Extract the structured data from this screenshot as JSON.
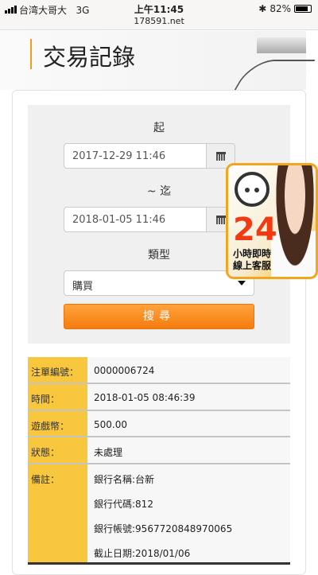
{
  "status": {
    "carrier": "台湾大哥大",
    "network": "3G",
    "time": "上午11:45",
    "url": "178591.net",
    "battery": "82%",
    "battery_level": 0.82
  },
  "header": {
    "title": "交易記錄"
  },
  "search": {
    "from_label": "起",
    "from_value": "2017-12-29 11:46",
    "to_label": "~ 迄",
    "to_value": "2018-01-05 11:46",
    "type_label": "類型",
    "type_value": "購買",
    "button": "搜尋"
  },
  "record": {
    "rows": [
      {
        "label": "注單編號：",
        "value": "0000006724"
      },
      {
        "label": "時間：",
        "value": "2018-01-05 08:46:39"
      },
      {
        "label": "遊戲幣：",
        "value": "500.00"
      },
      {
        "label": "狀態：",
        "value": "未處理"
      }
    ],
    "note_label": "備註：",
    "notes": [
      "銀行名稱:台新",
      "銀行代碼:812",
      "銀行帳號:9567720848970065",
      "截止日期:2018/01/06"
    ]
  },
  "ad": {
    "number": "24",
    "line1": "小時即時",
    "line2": "線上客服"
  }
}
